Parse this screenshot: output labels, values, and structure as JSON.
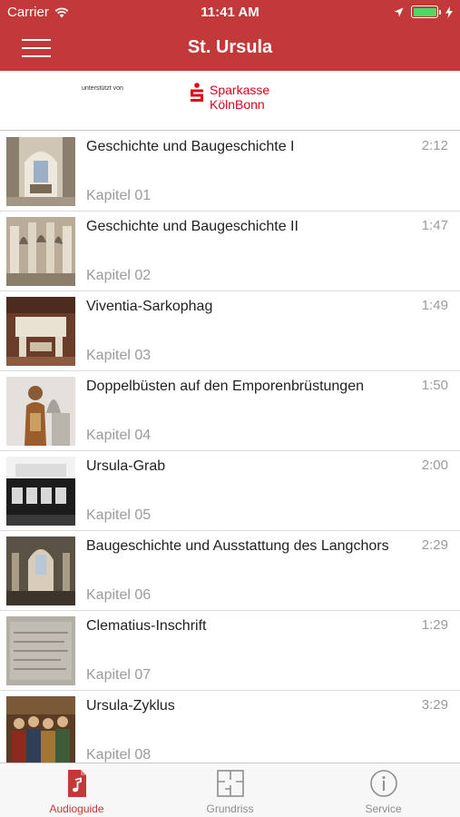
{
  "status_bar": {
    "carrier": "Carrier",
    "time": "11:41 AM",
    "wifi_icon": "wifi-icon",
    "location_icon": "location-arrow-icon",
    "battery_icon": "battery-icon",
    "charging_icon": "charging-bolt-icon"
  },
  "nav": {
    "title": "St. Ursula",
    "menu_icon": "hamburger-menu-icon"
  },
  "sponsor": {
    "supported_by": "unterstützt von",
    "logo_line1": "Sparkasse",
    "logo_line2": "KölnBonn",
    "brand_color": "#e2001a"
  },
  "tracks": [
    {
      "title": "Geschichte und  Baugeschichte I",
      "chapter": "Kapitel 01",
      "duration": "2:12"
    },
    {
      "title": "Geschichte und Baugeschichte II",
      "chapter": "Kapitel 02",
      "duration": "1:47"
    },
    {
      "title": "Viventia-Sarkophag",
      "chapter": "Kapitel 03",
      "duration": "1:49"
    },
    {
      "title": "Doppelbüsten auf den Emporenbrüstungen",
      "chapter": "Kapitel 04",
      "duration": "1:50"
    },
    {
      "title": "Ursula-Grab",
      "chapter": "Kapitel 05",
      "duration": "2:00"
    },
    {
      "title": "Baugeschichte und Ausstattung des Langchors",
      "chapter": "Kapitel 06",
      "duration": "2:29"
    },
    {
      "title": "Clematius-Inschrift",
      "chapter": "Kapitel 07",
      "duration": "1:29"
    },
    {
      "title": "Ursula-Zyklus",
      "chapter": "Kapitel 08",
      "duration": "3:29"
    }
  ],
  "tabs": [
    {
      "label": "Audioguide",
      "icon": "music-note-icon",
      "active": true
    },
    {
      "label": "Grundriss",
      "icon": "floor-plan-icon",
      "active": false
    },
    {
      "label": "Service",
      "icon": "info-icon",
      "active": false
    }
  ],
  "colors": {
    "accent": "#c3393a",
    "secondary_text": "#9b9b9b",
    "inactive_tab": "#8e8e8e"
  }
}
